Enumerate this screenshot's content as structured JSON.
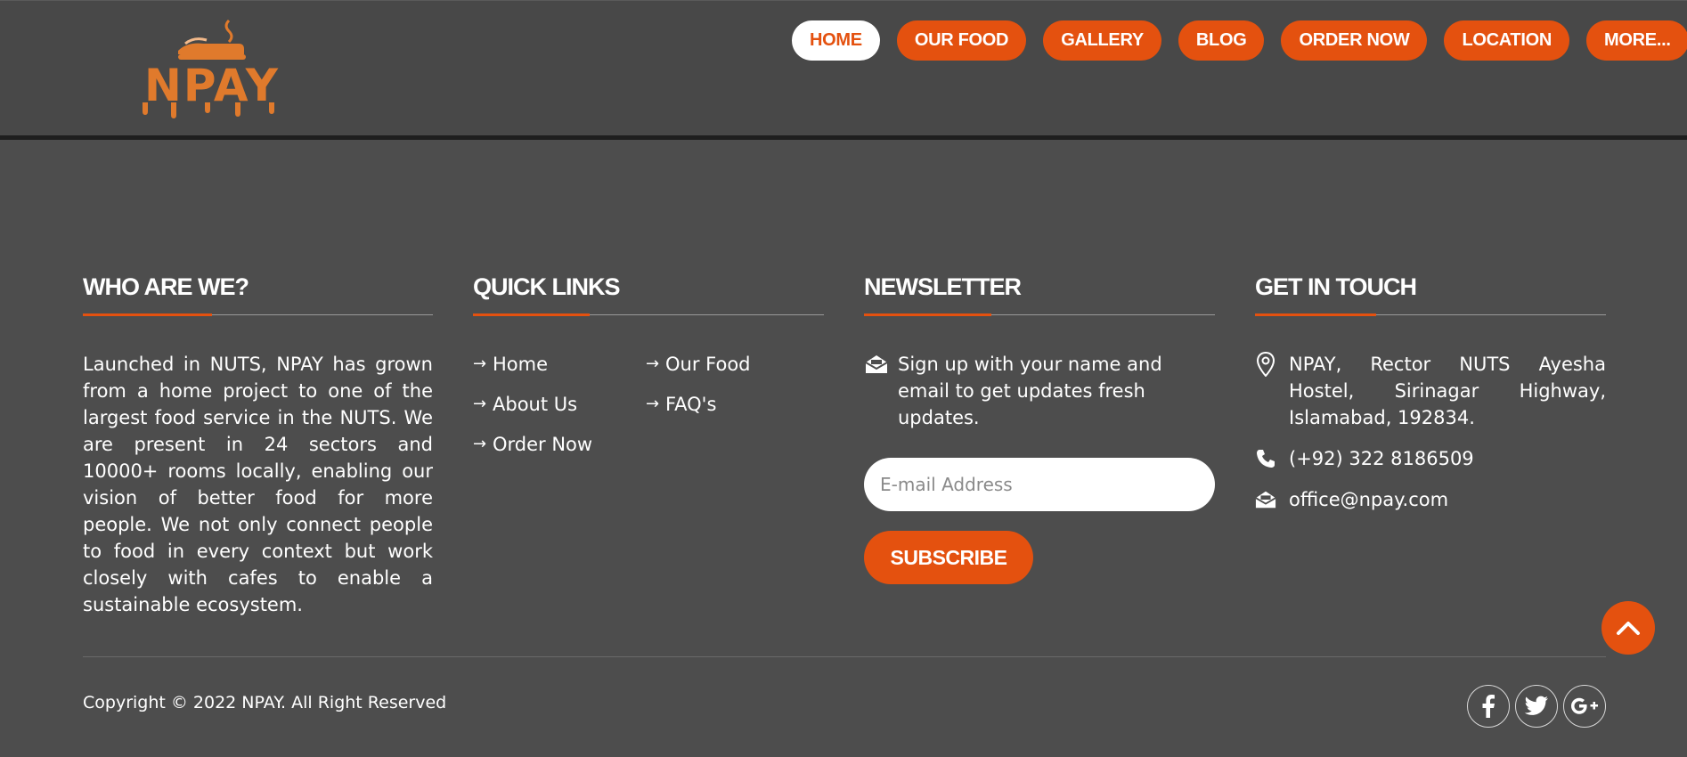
{
  "brand": {
    "logo_text": "NPAY",
    "accent_color": "#e4510f",
    "logo_color": "#e07a2c"
  },
  "nav": {
    "items": [
      {
        "label": "HOME",
        "active": true
      },
      {
        "label": "OUR FOOD",
        "active": false
      },
      {
        "label": "GALLERY",
        "active": false
      },
      {
        "label": "BLOG",
        "active": false
      },
      {
        "label": "ORDER NOW",
        "active": false
      },
      {
        "label": "LOCATION",
        "active": false
      },
      {
        "label": "MORE...",
        "active": false
      }
    ]
  },
  "footer": {
    "who": {
      "title": "WHO ARE WE?",
      "text": "Launched in NUTS, NPAY has grown from a home project to one of the largest food service in the NUTS. We are present in 24 sectors and 10000+ rooms locally, enabling our vision of better food for more people. We not only connect people to food in every context but work closely with cafes to enable a sustainable ecosystem."
    },
    "quick_links": {
      "title": "QUICK LINKS",
      "items": [
        "Home",
        "Our Food",
        "About Us",
        "FAQ's",
        "Order Now"
      ]
    },
    "newsletter": {
      "title": "NEWSLETTER",
      "text": "Sign up with your name and email to get updates fresh updates.",
      "email_placeholder": "E-mail Address",
      "email_value": "",
      "subscribe_label": "SUBSCRIBE",
      "icon": "envelope-open-icon"
    },
    "contact": {
      "title": "GET IN TOUCH",
      "address": "NPAY, Rector NUTS Ayesha Hostel, Sirinagar Highway, Islamabad, 192834.",
      "phone": "(+92) 322 8186509",
      "email": "office@npay.com",
      "icons": [
        "location-pin-icon",
        "phone-icon",
        "envelope-open-icon"
      ]
    },
    "copyright": "Copyright © 2022 NPAY. All Right Reserved",
    "social": [
      "facebook-icon",
      "twitter-icon",
      "google-plus-icon"
    ],
    "scroll_top_icon": "chevron-up-icon"
  }
}
